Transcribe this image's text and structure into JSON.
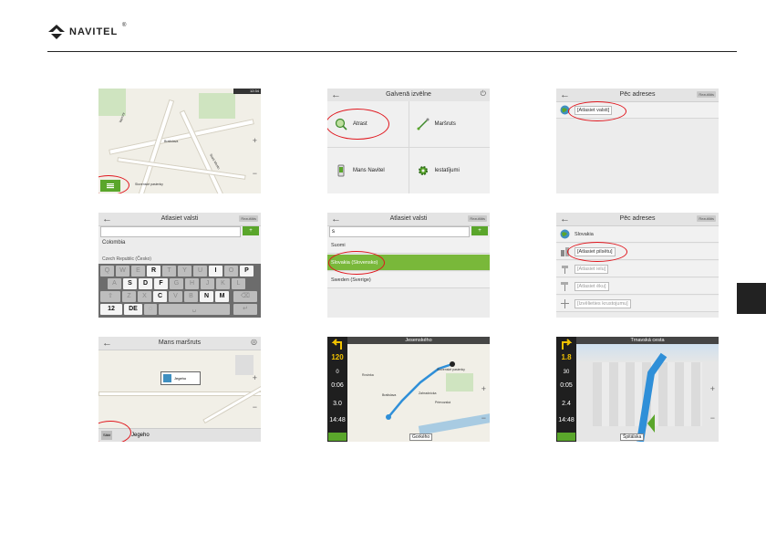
{
  "brand": {
    "name": "NAVITEL",
    "reg": "®"
  },
  "s1": {
    "labels": {
      "a": "Bratislava",
      "b": "Vajnory",
      "c": "Slovenské pasienky",
      "d": "Staré Mesto"
    },
    "status": "12:34"
  },
  "s2": {
    "title": "Galvenā izvēlne",
    "items": [
      {
        "label": "Atrast",
        "icon": "magnifier-icon"
      },
      {
        "label": "Maršruts",
        "icon": "route-icon"
      },
      {
        "label": "Mans Navitel",
        "icon": "navitel-icon"
      },
      {
        "label": "Iestatījumi",
        "icon": "gear-icon"
      }
    ]
  },
  "s3": {
    "title": "Pēc adreses",
    "right_btn": "Rezultāts",
    "row": "[Atlasiet valsti]"
  },
  "s4": {
    "title": "Atlasiet valsti",
    "right_btn": "Rezultāts",
    "rows": [
      "Colombia",
      "Czech Republic (Česko)"
    ],
    "keys_row1": [
      "Q",
      "W",
      "E",
      "R",
      "T",
      "Y",
      "U",
      "I",
      "O",
      "P"
    ],
    "keys_row2": [
      "A",
      "S",
      "D",
      "F",
      "G",
      "H",
      "J",
      "K",
      "L"
    ],
    "keys_row3": [
      "Z",
      "X",
      "C",
      "V",
      "B",
      "N",
      "M"
    ],
    "keys_row4": [
      "12",
      "DE"
    ]
  },
  "s5": {
    "title": "Atlasiet valsti",
    "right_btn": "Rezultāts",
    "input": "s",
    "rows": [
      "Suomi",
      "Slovakia (Slovensko)",
      "Sweden (Sverige)"
    ]
  },
  "s6": {
    "title": "Pēc adreses",
    "right_btn": "Rezultāts",
    "rows": [
      "Slovakia",
      "[Atlasiet pilsētu]",
      "[Atlasiet ielu]",
      "[Atlasiet ēku]",
      "[Izvēlieties krustojumu]"
    ]
  },
  "s7": {
    "title": "Mans maršruts",
    "popup": "Jegeho",
    "bottom_btn": "Sākt",
    "bottom_text": "Jegeho"
  },
  "s8": {
    "street_top": "Jesenského",
    "street_bottom": "Gorkého",
    "panel": [
      "120",
      "0",
      "0:06",
      "3.0",
      "14:48"
    ],
    "labels": [
      "Bratislava",
      "Rovinka",
      "Slovenské pasienky",
      "Zahradnícka",
      "Prievozská",
      "Jesenského"
    ]
  },
  "s9": {
    "street_top": "Trnavská cesta",
    "street_bottom": "Špitálska",
    "panel": [
      "1.8",
      "30",
      "0:05",
      "2.4",
      "14:48"
    ]
  },
  "colors": {
    "accent_green": "#5aa62b",
    "ring_red": "#e0151c"
  }
}
